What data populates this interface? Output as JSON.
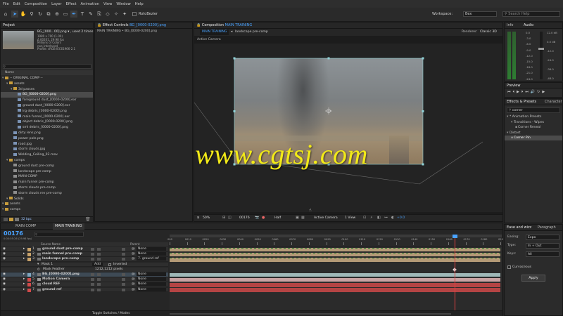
{
  "menu": [
    "File",
    "Edit",
    "Composition",
    "Layer",
    "Effect",
    "Animation",
    "View",
    "Window",
    "Help"
  ],
  "toolbar": {
    "tool_label": "RotoBezier",
    "workspace_label": "Workspace:",
    "workspace_value": "Bex",
    "search_help": "Search Help"
  },
  "project": {
    "tab": "Project",
    "item_name": "BG_[000...00].png ▾ , used 2 times",
    "item_meta": [
      "1980 x 700 (1.00)",
      "Δ 00201, 29.98 fps",
      "Millions of Colors",
      "non-interlaced",
      "Profile: sRGB IEC61966-2.1"
    ],
    "col_name": "Name",
    "tree": [
      {
        "depth": 0,
        "type": "folder",
        "label": "-- ORIGINAL COMP --"
      },
      {
        "depth": 1,
        "type": "folder",
        "label": "assets"
      },
      {
        "depth": 2,
        "type": "folder",
        "label": "3d passes"
      },
      {
        "depth": 3,
        "type": "img",
        "label": "BG_[0000-0200].png",
        "selected": true
      },
      {
        "depth": 3,
        "type": "img",
        "label": "foreground dust_[0000-0200].exr"
      },
      {
        "depth": 3,
        "type": "img",
        "label": "ground dust_[0000-0200].exr"
      },
      {
        "depth": 3,
        "type": "img",
        "label": "lrg debris_[0000-0200].png"
      },
      {
        "depth": 3,
        "type": "img",
        "label": "main funnel_[0000-0200].exr"
      },
      {
        "depth": 3,
        "type": "img",
        "label": "object debris_[0000-0200].png"
      },
      {
        "depth": 3,
        "type": "img",
        "label": "sml debris_[0000-0200].png"
      },
      {
        "depth": 2,
        "type": "img",
        "label": "dirty lens.png"
      },
      {
        "depth": 2,
        "type": "img",
        "label": "power pole.png"
      },
      {
        "depth": 2,
        "type": "img",
        "label": "road.jpg"
      },
      {
        "depth": 2,
        "type": "img",
        "label": "storm clouds.jpg"
      },
      {
        "depth": 2,
        "type": "img",
        "label": "Welding_Ceiling_02.mov"
      },
      {
        "depth": 1,
        "type": "folder",
        "label": "comps"
      },
      {
        "depth": 2,
        "type": "comp",
        "label": "ground dust pre-comp"
      },
      {
        "depth": 2,
        "type": "comp",
        "label": "landscape pre-comp"
      },
      {
        "depth": 2,
        "type": "comp",
        "label": "MAIN COMP"
      },
      {
        "depth": 2,
        "type": "comp",
        "label": "main funnel pre-comp"
      },
      {
        "depth": 2,
        "type": "comp",
        "label": "storm clouds pre-comp"
      },
      {
        "depth": 2,
        "type": "comp",
        "label": "storm clouds rev pre-comp"
      },
      {
        "depth": 1,
        "type": "folder",
        "label": "Solids"
      },
      {
        "depth": 0,
        "type": "folder",
        "label": "assets"
      },
      {
        "depth": 0,
        "type": "folder",
        "label": "comps"
      }
    ],
    "footer_bpc": "32 bpc"
  },
  "effect_controls": {
    "tab": "Effect Controls",
    "tab_item": "BG_[0000-0200].png",
    "breadcrumb": "MAIN TRAINING • BG_[0000-0200].png"
  },
  "composition": {
    "tab": "Composition",
    "tab_item": "MAIN TRAINING",
    "crumb_active": "MAIN TRAINING",
    "crumb_next": "landscape pre-comp",
    "renderer_label": "Renderer:",
    "renderer_value": "Classic 3D",
    "active_camera": "Active Camera",
    "footer": {
      "zoom": "50%",
      "timecode": "00176",
      "resolution": "Half",
      "view": "Active Camera",
      "views": "1 View",
      "exposure": "+0.0"
    }
  },
  "watermark": "www.cgtsj.com",
  "info": {
    "tab_info": "Info",
    "tab_audio": "Audio",
    "db_right": [
      "12.0 dB",
      "0.0 dB",
      "-12.0",
      "-24.0",
      "-36.0",
      "-48.0"
    ],
    "db_left": [
      "0.0",
      "-3.0",
      "-6.0",
      "-9.0",
      "-12.0",
      "-15.0",
      "-18.0",
      "-21.0",
      "-24.0"
    ]
  },
  "preview": {
    "tab": "Preview"
  },
  "effects_presets": {
    "tab": "Effects & Presets",
    "tab_char": "Character",
    "search": "corner",
    "tree": [
      {
        "depth": 0,
        "label": "* Animation Presets"
      },
      {
        "depth": 1,
        "label": "Transitions - Wipes"
      },
      {
        "depth": 2,
        "label": "Corner Reveal"
      },
      {
        "depth": 0,
        "label": "Distort"
      },
      {
        "depth": 1,
        "label": "Corner Pin",
        "selected": true
      }
    ]
  },
  "ease": {
    "tab": "Ease and wizz",
    "tab2": "Paragraph",
    "fields": [
      {
        "label": "Easing:",
        "value": "Expo"
      },
      {
        "label": "Type:",
        "value": "In + Out"
      },
      {
        "label": "Keys:",
        "value": "All"
      }
    ],
    "checkbox": "Curvaceous",
    "apply": "Apply"
  },
  "timeline": {
    "tabs": [
      "MAIN COMP",
      "MAIN TRAINING"
    ],
    "timecode": "00176",
    "timecode_sub": "0:00:05:26 (29.98 fps)",
    "col_source": "Source Name",
    "col_parent": "Parent",
    "ruler": [
      "000",
      "0010",
      "0020",
      "0030",
      "0040",
      "0050",
      "0060",
      "0070",
      "0080",
      "0090",
      "0100",
      "0110",
      "0120",
      "0130",
      "0140",
      "0150",
      "0160",
      "0170",
      "0180",
      "020"
    ],
    "layers": [
      {
        "num": "1",
        "name": "ground dust pre-comp",
        "color": "#c8a26a",
        "parent": "None",
        "bar": "#b49a77"
      },
      {
        "num": "2",
        "name": "main funnel pre-comp",
        "color": "#c8a26a",
        "parent": "None",
        "bar": "#b49a77"
      },
      {
        "num": "3",
        "name": "landscape pre-comp",
        "color": "#c8a26a",
        "parent": "7. ground ref",
        "bar": "#b49a77"
      },
      {
        "mask": true,
        "name": "Mask 1",
        "mode": "Add",
        "inverted": "Inverted"
      },
      {
        "mask_prop": true,
        "name": "Mask Feather",
        "value": "1212,1212 pixels"
      },
      {
        "num": "4",
        "name": "BG_[0000-0200].png",
        "color": "#7fa7c0",
        "parent": "None",
        "bar": "#9fb9b9",
        "selected": true
      },
      {
        "num": "5",
        "name": "Motion Camera",
        "color": "#d24a4a",
        "parent": "None",
        "bar": "#c9a3a3"
      },
      {
        "num": "6",
        "name": "cloud REF",
        "color": "#d24a4a",
        "parent": "None",
        "bar": "#b54444"
      },
      {
        "num": "7",
        "name": "ground ref",
        "color": "#d24a4a",
        "parent": "None",
        "bar": "#b54444"
      }
    ],
    "toggle_label": "Toggle Switches / Modes"
  }
}
